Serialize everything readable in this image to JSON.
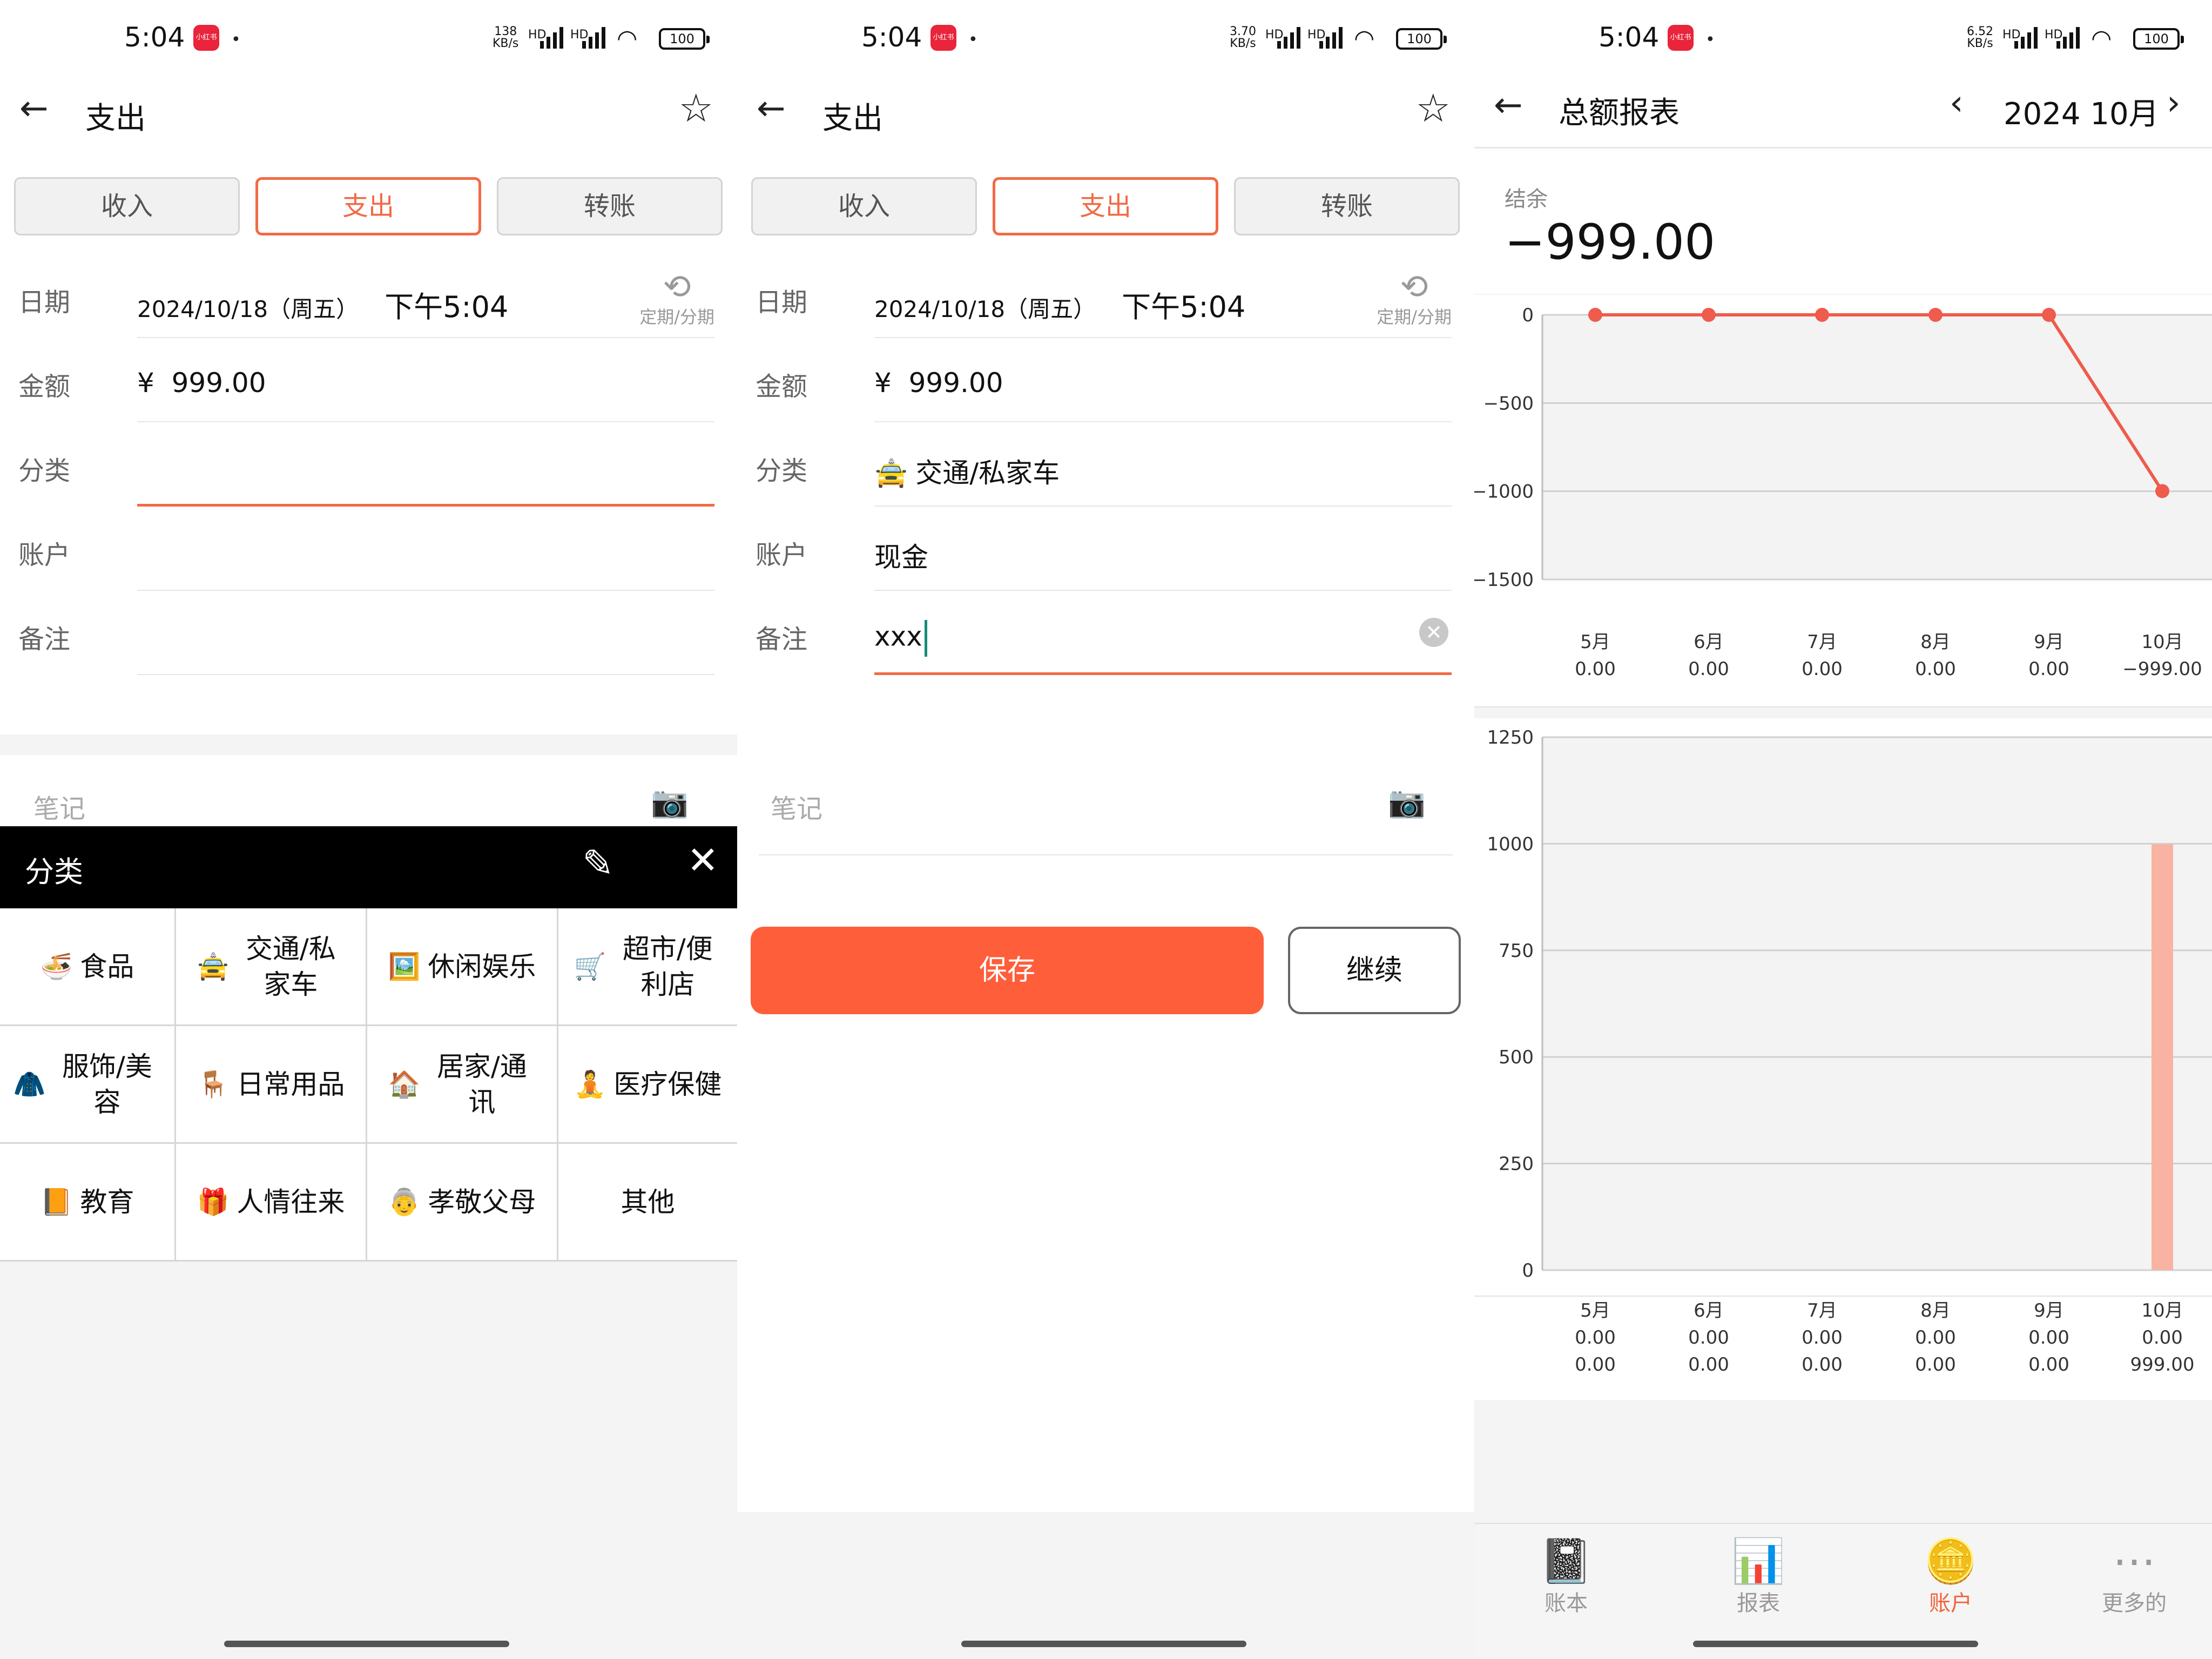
{
  "status": {
    "time": "5:04",
    "notif": "小红书",
    "speed1": "138\nKB/s",
    "speed2": "3.70\nKB/s",
    "speed3": "6.52\nKB/s",
    "hd": "HD",
    "battery": "100"
  },
  "screen1": {
    "title": "支出",
    "tabs": [
      "收入",
      "支出",
      "转账"
    ],
    "date_label": "日期",
    "date_value": "2024/10/18（周五）",
    "time_value": "下午5:04",
    "cycle_label": "定期/分期",
    "amount_label": "金额",
    "amount_value": "¥  999.00",
    "category_label": "分类",
    "account_label": "账户",
    "remark_label": "备注",
    "note_label": "笔记",
    "popup_title": "分类",
    "categories": [
      {
        "icon": "🍜",
        "label": "食品"
      },
      {
        "icon": "🚖",
        "label": "交通/私家车"
      },
      {
        "icon": "🖼️",
        "label": "休闲娱乐"
      },
      {
        "icon": "🛒",
        "label": "超市/便利店"
      },
      {
        "icon": "🧥",
        "label": "服饰/美容"
      },
      {
        "icon": "🪑",
        "label": "日常用品"
      },
      {
        "icon": "🏠",
        "label": "居家/通讯"
      },
      {
        "icon": "🧘",
        "label": "医疗保健"
      },
      {
        "icon": "📙",
        "label": "教育"
      },
      {
        "icon": "🎁",
        "label": "人情往来"
      },
      {
        "icon": "👵",
        "label": "孝敬父母"
      },
      {
        "icon": "",
        "label": "其他"
      }
    ]
  },
  "screen2": {
    "title": "支出",
    "tabs": [
      "收入",
      "支出",
      "转账"
    ],
    "date_label": "日期",
    "date_value": "2024/10/18（周五）",
    "time_value": "下午5:04",
    "cycle_label": "定期/分期",
    "amount_label": "金额",
    "amount_value": "¥  999.00",
    "category_label": "分类",
    "category_icon": "🚖",
    "category_value": "交通/私家车",
    "account_label": "账户",
    "account_value": "现金",
    "remark_label": "备注",
    "remark_value": "xxx",
    "note_label": "笔记",
    "save_label": "保存",
    "continue_label": "继续"
  },
  "screen3": {
    "title": "总额报表",
    "month": "2024 10月",
    "balance_label": "结余",
    "balance_value": "−999.00",
    "tabbar": [
      {
        "icon": "📓",
        "label": "账本",
        "active": false
      },
      {
        "icon": "📊",
        "label": "报表",
        "active": false
      },
      {
        "icon": "🪙",
        "label": "账户",
        "active": true
      },
      {
        "icon": "⋯",
        "label": "更多的",
        "active": false
      }
    ]
  },
  "colors": {
    "accent": "#f26a45",
    "save": "#ff5e3a",
    "line": "#ef5b4c",
    "bar": "#f8b3a3",
    "income": "#2a7fc1",
    "expense": "#e05a3e"
  },
  "chart_data": [
    {
      "type": "line",
      "categories": [
        "5月",
        "6月",
        "7月",
        "8月",
        "9月",
        "10月"
      ],
      "values": [
        0,
        0,
        0,
        0,
        0,
        -999
      ],
      "value_labels": [
        "0.00",
        "0.00",
        "0.00",
        "0.00",
        "0.00",
        "−999.00"
      ],
      "yticks": [
        "0",
        "−500",
        "−1000",
        "−1500"
      ],
      "ylim": [
        -1500,
        0
      ]
    },
    {
      "type": "bar",
      "categories": [
        "5月",
        "6月",
        "7月",
        "8月",
        "9月",
        "10月"
      ],
      "series": [
        {
          "values": [
            0,
            0,
            0,
            0,
            0,
            0
          ],
          "labels": [
            "0.00",
            "0.00",
            "0.00",
            "0.00",
            "0.00",
            "0.00"
          ]
        },
        {
          "values": [
            0,
            0,
            0,
            0,
            0,
            999
          ],
          "labels": [
            "0.00",
            "0.00",
            "0.00",
            "0.00",
            "0.00",
            "999.00"
          ]
        }
      ],
      "yticks": [
        "1250",
        "1000",
        "750",
        "500",
        "250",
        "0"
      ],
      "ylim": [
        0,
        1250
      ]
    }
  ]
}
